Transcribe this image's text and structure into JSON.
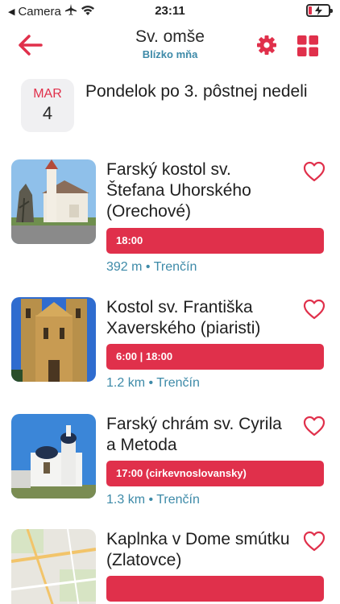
{
  "status_bar": {
    "back_label": "Camera",
    "time": "23:11",
    "back_arrow_icon": "small-back-triangle-icon",
    "airplane_icon": "airplane-icon",
    "wifi_icon": "wifi-icon",
    "battery_icon": "battery-charging-icon",
    "battery_level": 0.15
  },
  "header": {
    "title": "Sv. omše",
    "subtitle": "Blízko mňa",
    "back_icon": "arrow-left-icon",
    "settings_icon": "gear-icon",
    "layout_icon": "grid-icon"
  },
  "date": {
    "month": "MAR",
    "day": "4",
    "title": "Pondelok po 3. pôstnej nedeli"
  },
  "colors": {
    "accent": "#e0304b",
    "link": "#3d8aa8",
    "tile_bg": "#f0f0f2"
  },
  "churches": [
    {
      "name": "Farský kostol sv. Štefana Uhorského (Orechové)",
      "times": "18:00",
      "distance": "392 m",
      "separator": "•",
      "city": "Trenčín",
      "favorite_icon": "heart-outline-icon"
    },
    {
      "name": "Kostol sv. Františka Xaverského (piaristi)",
      "times": "6:00 | 18:00",
      "distance": "1.2 km",
      "separator": "•",
      "city": "Trenčín",
      "favorite_icon": "heart-outline-icon"
    },
    {
      "name": "Farský chrám sv. Cyrila a Metoda",
      "times": "17:00 (cirkevnoslovansky)",
      "distance": "1.3 km",
      "separator": "•",
      "city": "Trenčín",
      "favorite_icon": "heart-outline-icon"
    },
    {
      "name": "Kaplnka v Dome smútku (Zlatovce)",
      "times": "",
      "distance": "",
      "separator": "",
      "city": "",
      "favorite_icon": "heart-outline-icon"
    }
  ]
}
